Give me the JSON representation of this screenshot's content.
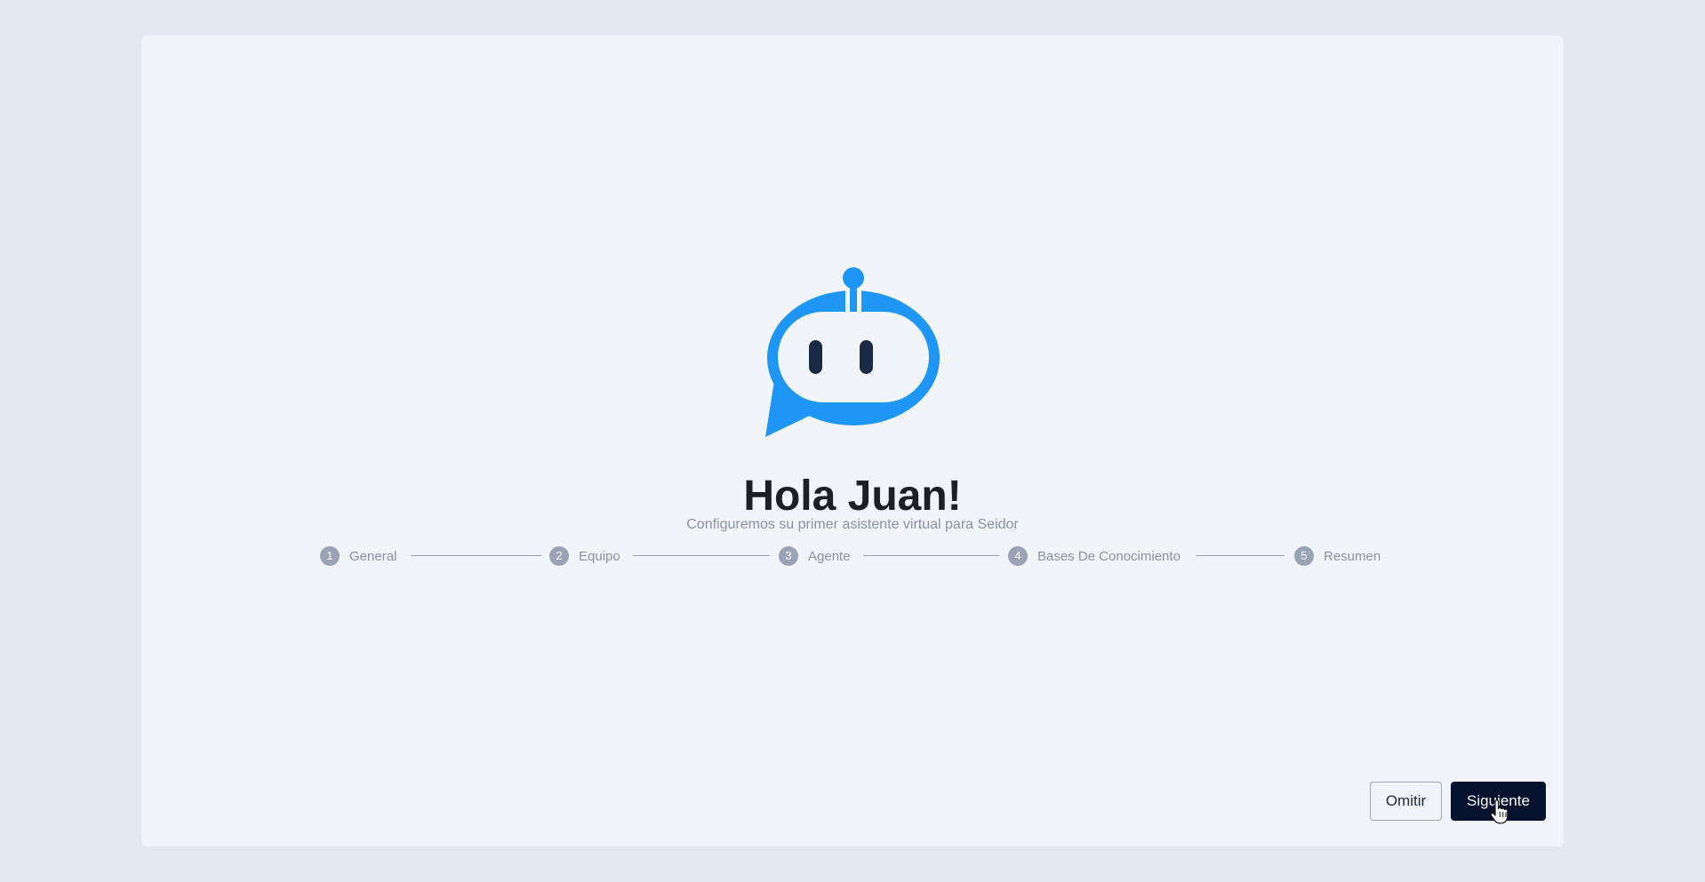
{
  "greeting": {
    "title": "Hola Juan!",
    "subtitle": "Configuremos su primer asistente virtual para Seidor"
  },
  "logo": {
    "icon": "chat-bot-icon",
    "color": "#1e96f5",
    "eye_color": "#1a2a44"
  },
  "steps": [
    {
      "number": "1",
      "label": "General"
    },
    {
      "number": "2",
      "label": "Equipo"
    },
    {
      "number": "3",
      "label": "Agente"
    },
    {
      "number": "4",
      "label": "Bases De Conocimiento"
    },
    {
      "number": "5",
      "label": "Resumen"
    }
  ],
  "actions": {
    "skip_label": "Omitir",
    "next_label": "Siguiente"
  },
  "colors": {
    "background": "#e3e8f0",
    "card": "#f1f5f9",
    "primary_button": "#07122f",
    "step_inactive": "#9aa3b6"
  }
}
